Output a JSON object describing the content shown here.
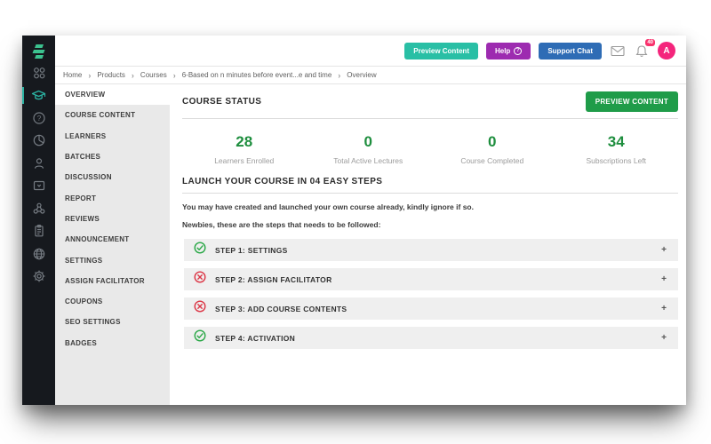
{
  "topbar": {
    "preview_content": "Preview Content",
    "help": "Help",
    "help_symbol": "?",
    "support_chat": "Support Chat",
    "notification_count": "40",
    "avatar_initial": "A"
  },
  "breadcrumb": {
    "separator": "›",
    "items": [
      "Home",
      "Products",
      "Courses",
      "6-Based on n minutes before event...e and time",
      "Overview"
    ]
  },
  "rail_icons": [
    "stacked-bars-logo",
    "apps-grid-icon",
    "graduation-cap-icon",
    "help-circle-icon",
    "pie-chart-icon",
    "user-icon",
    "media-card-icon",
    "share-nodes-icon",
    "clipboard-icon",
    "globe-icon",
    "gear-icon"
  ],
  "menu": {
    "items": [
      {
        "label": "OVERVIEW",
        "active": true
      },
      {
        "label": "COURSE CONTENT",
        "active": false
      },
      {
        "label": "LEARNERS",
        "active": false
      },
      {
        "label": "BATCHES",
        "active": false
      },
      {
        "label": "DISCUSSION",
        "active": false
      },
      {
        "label": "REPORT",
        "active": false
      },
      {
        "label": "REVIEWS",
        "active": false
      },
      {
        "label": "ANNOUNCEMENT",
        "active": false
      },
      {
        "label": "SETTINGS",
        "active": false
      },
      {
        "label": "ASSIGN FACILITATOR",
        "active": false
      },
      {
        "label": "COUPONS",
        "active": false
      },
      {
        "label": "SEO SETTINGS",
        "active": false
      },
      {
        "label": "BADGES",
        "active": false
      }
    ]
  },
  "status": {
    "title": "COURSE STATUS",
    "preview_button": "PREVIEW CONTENT",
    "stats": [
      {
        "value": "28",
        "label": "Learners Enrolled"
      },
      {
        "value": "0",
        "label": "Total Active Lectures"
      },
      {
        "value": "0",
        "label": "Course Completed"
      },
      {
        "value": "34",
        "label": "Subscriptions Left"
      }
    ]
  },
  "launch": {
    "title": "LAUNCH YOUR COURSE IN 04 EASY STEPS",
    "note1": "You may have created and launched your own course already, kindly ignore if so.",
    "note2": "Newbies, these are the steps that needs to be followed:",
    "expand_symbol": "+",
    "steps": [
      {
        "label": "STEP 1: SETTINGS",
        "status": "complete"
      },
      {
        "label": "STEP 2: ASSIGN FACILITATOR",
        "status": "incomplete"
      },
      {
        "label": "STEP 3: ADD COURSE CONTENTS",
        "status": "incomplete"
      },
      {
        "label": "STEP 4: ACTIVATION",
        "status": "complete"
      }
    ]
  },
  "colors": {
    "rail_dark": "#16191e",
    "rail_active_teal": "#2bb3a3",
    "logo_green": "#3cc28f",
    "btn_teal": "#29bfa5",
    "btn_purple": "#9d2bb0",
    "btn_blue": "#2e6cb5",
    "btn_green": "#1f9c49",
    "stat_green": "#1e8e3e",
    "avatar_pink": "#f4257c",
    "badge_pink": "#f8316c",
    "success_green": "#28a745",
    "danger_red": "#dc3545",
    "menu_gray": "#e9e9e9",
    "step_gray": "#efefef"
  }
}
